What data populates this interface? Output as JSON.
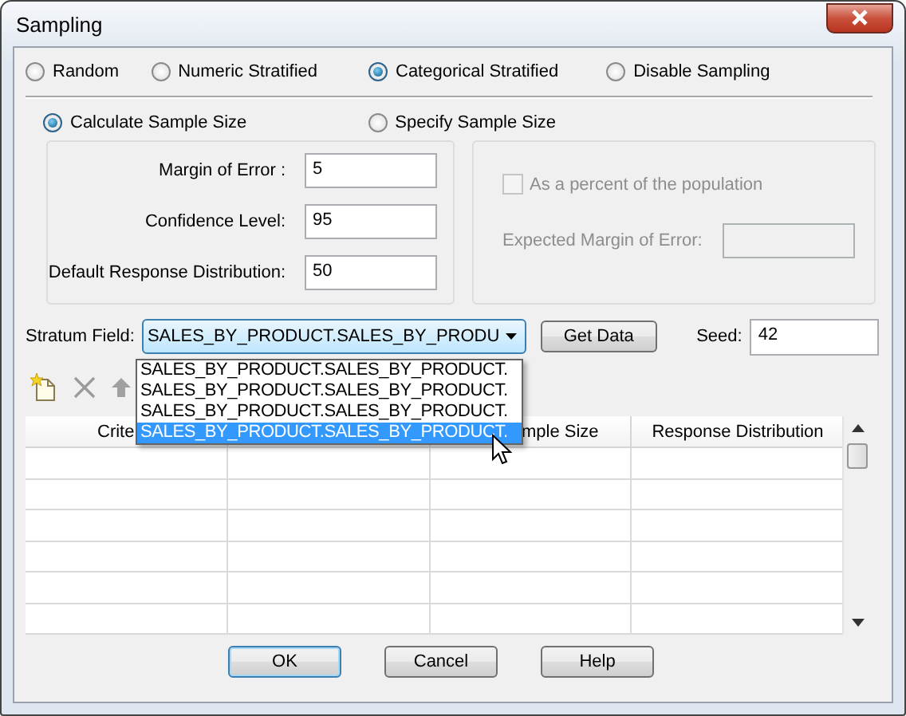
{
  "window": {
    "title": "Sampling"
  },
  "sampling_methods": [
    {
      "label": "Random",
      "selected": false
    },
    {
      "label": "Numeric Stratified",
      "selected": false
    },
    {
      "label": "Categorical Stratified",
      "selected": true
    },
    {
      "label": "Disable Sampling",
      "selected": false
    }
  ],
  "sample_size_modes": [
    {
      "label": "Calculate Sample Size",
      "selected": true
    },
    {
      "label": "Specify Sample Size",
      "selected": false
    }
  ],
  "calculate_fields": [
    {
      "label": "Margin of Error :",
      "value": "5"
    },
    {
      "label": "Confidence Level:",
      "value": "95"
    },
    {
      "label": "Default Response Distribution:",
      "value": "50"
    }
  ],
  "specify": {
    "percent_checkbox": {
      "label": "As a percent of the population",
      "checked": false,
      "disabled": true
    },
    "expected_margin": {
      "label": "Expected Margin of Error:",
      "disabled": true
    }
  },
  "stratum_field": {
    "label": "Stratum Field:",
    "value": "SALES_BY_PRODUCT.SALES_BY_PRODU",
    "expanded": true,
    "options": [
      {
        "label": "SALES_BY_PRODUCT.SALES_BY_PRODUCT.",
        "selected": false
      },
      {
        "label": "SALES_BY_PRODUCT.SALES_BY_PRODUCT.",
        "selected": false
      },
      {
        "label": "SALES_BY_PRODUCT.SALES_BY_PRODUCT.",
        "selected": false
      },
      {
        "label": "SALES_BY_PRODUCT.SALES_BY_PRODUCT.",
        "selected": true
      }
    ]
  },
  "get_data_button": "Get Data",
  "seed": {
    "label": "Seed:",
    "value": "42"
  },
  "table": {
    "columns": [
      {
        "label": "Crite"
      },
      {},
      {
        "label": "mple Size"
      },
      {
        "label": "Response Distribution"
      }
    ]
  },
  "buttons": [
    {
      "label": "OK",
      "default": true
    },
    {
      "label": "Cancel",
      "default": false
    },
    {
      "label": "Help",
      "default": false
    }
  ]
}
